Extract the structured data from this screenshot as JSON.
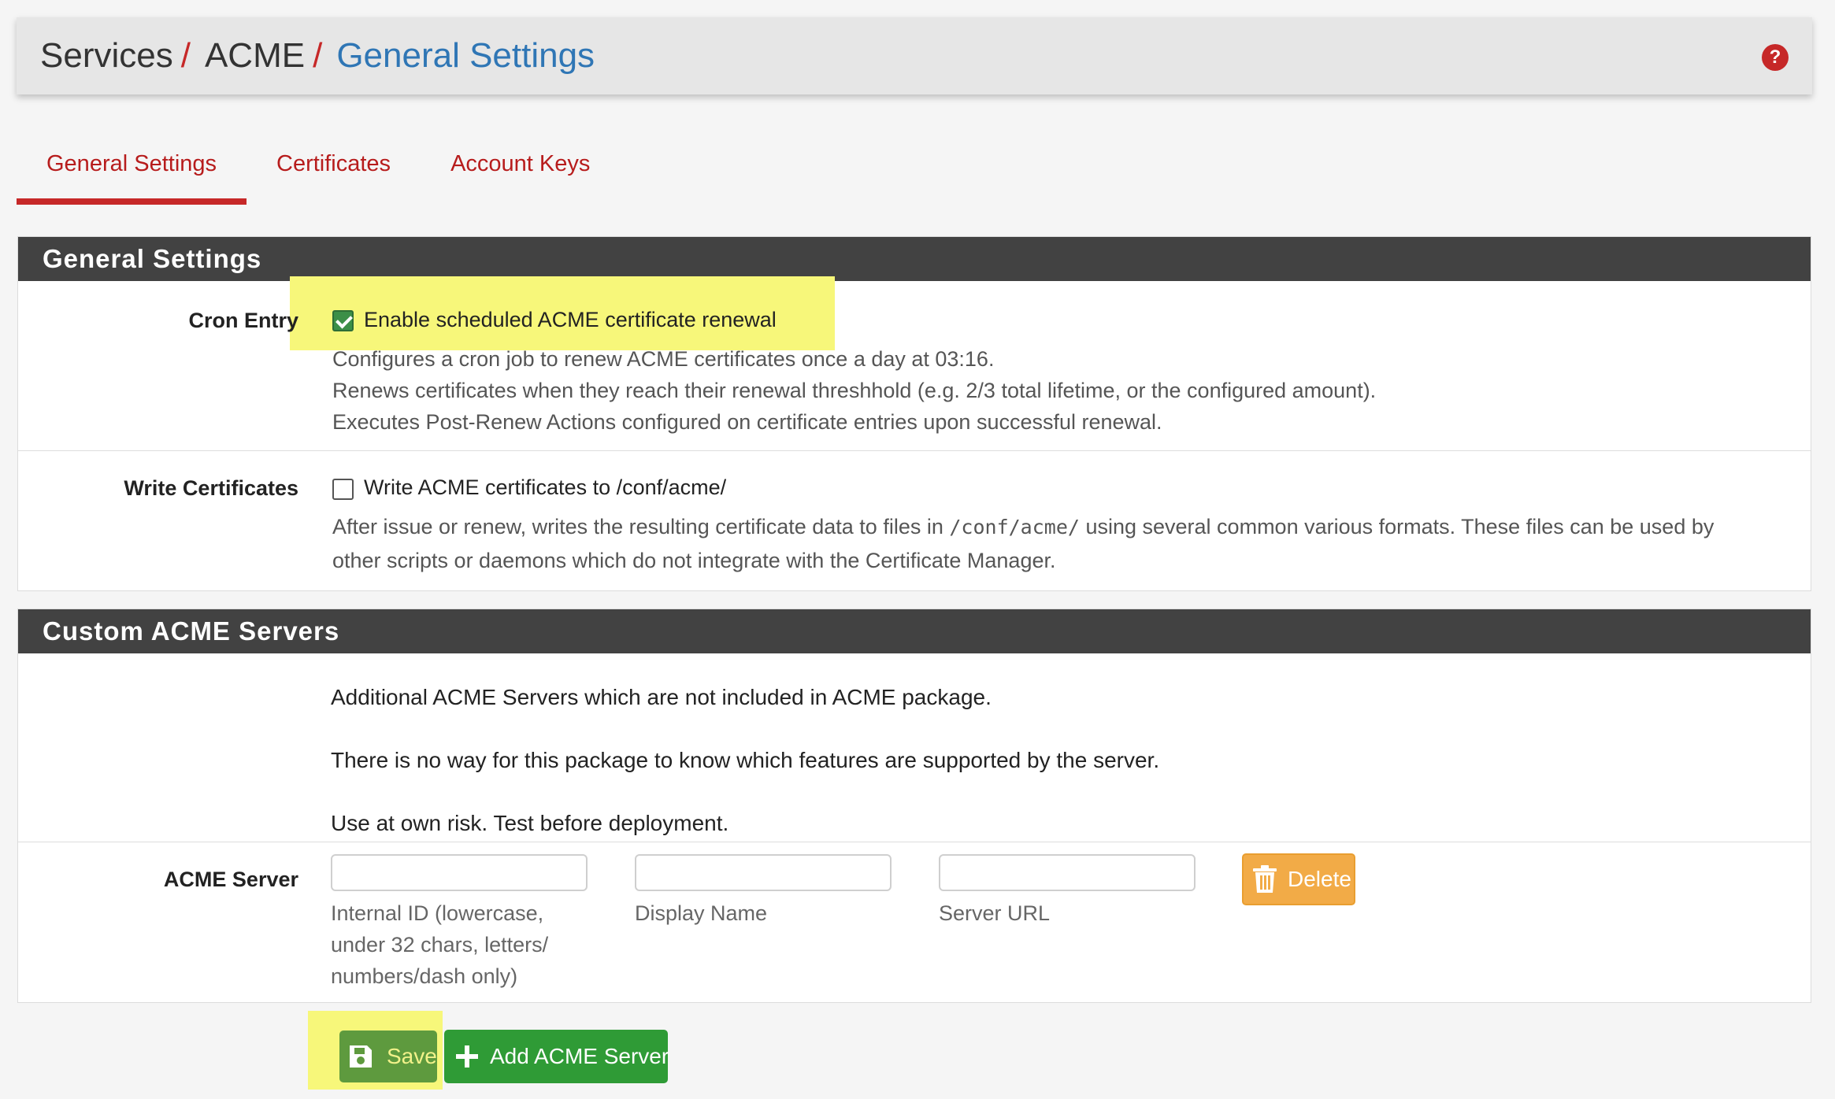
{
  "breadcrumb": {
    "items": [
      "Services",
      "ACME"
    ],
    "separator": "/",
    "current": "General Settings"
  },
  "help_icon": "?",
  "tabs": [
    {
      "label": "General Settings",
      "active": true
    },
    {
      "label": "Certificates",
      "active": false
    },
    {
      "label": "Account Keys",
      "active": false
    }
  ],
  "general_settings": {
    "heading": "General Settings",
    "cron_entry": {
      "label": "Cron Entry",
      "checkbox_label": "Enable scheduled ACME certificate renewal",
      "checked": true,
      "help": [
        "Configures a cron job to renew ACME certificates once a day at 03:16.",
        "Renews certificates when they reach their renewal threshhold (e.g. 2/3 total lifetime, or the configured amount).",
        "Executes Post-Renew Actions configured on certificate entries upon successful renewal."
      ]
    },
    "write_certificates": {
      "label": "Write Certificates",
      "checkbox_label": "Write ACME certificates to /conf/acme/",
      "checked": false,
      "help_prefix": "After issue or renew, writes the resulting certificate data to files in",
      "help_code": "/conf/acme/",
      "help_suffix": "using several common various formats. These files can be used by",
      "help_line2": "other scripts or daemons which do not integrate with the Certificate Manager."
    }
  },
  "custom_servers": {
    "heading": "Custom ACME Servers",
    "notes": [
      "Additional ACME Servers which are not included in ACME package.",
      "There is no way for this package to know which features are supported by the server.",
      "Use at own risk. Test before deployment."
    ],
    "acme_server": {
      "label": "ACME Server",
      "fields": [
        {
          "value": "",
          "help": [
            "Internal ID (lowercase,",
            "under 32 chars, letters/",
            "numbers/dash only)"
          ]
        },
        {
          "value": "",
          "help": [
            "Display Name"
          ]
        },
        {
          "value": "",
          "help": [
            "Server URL"
          ]
        }
      ],
      "delete_label": "Delete"
    }
  },
  "actions": {
    "save_label": "Save",
    "add_label": "Add ACME Server"
  },
  "colors": {
    "accent_red": "#c62828",
    "link_blue": "#2f76b5",
    "panel_heading": "#424242",
    "highlight_yellow": "#f7f77a",
    "delete_orange": "#f2ab47",
    "success_green": "#2f9b36"
  },
  "icons": {
    "help": "question-circle-icon",
    "delete": "trash-icon",
    "save": "save-icon",
    "add": "plus-icon"
  }
}
